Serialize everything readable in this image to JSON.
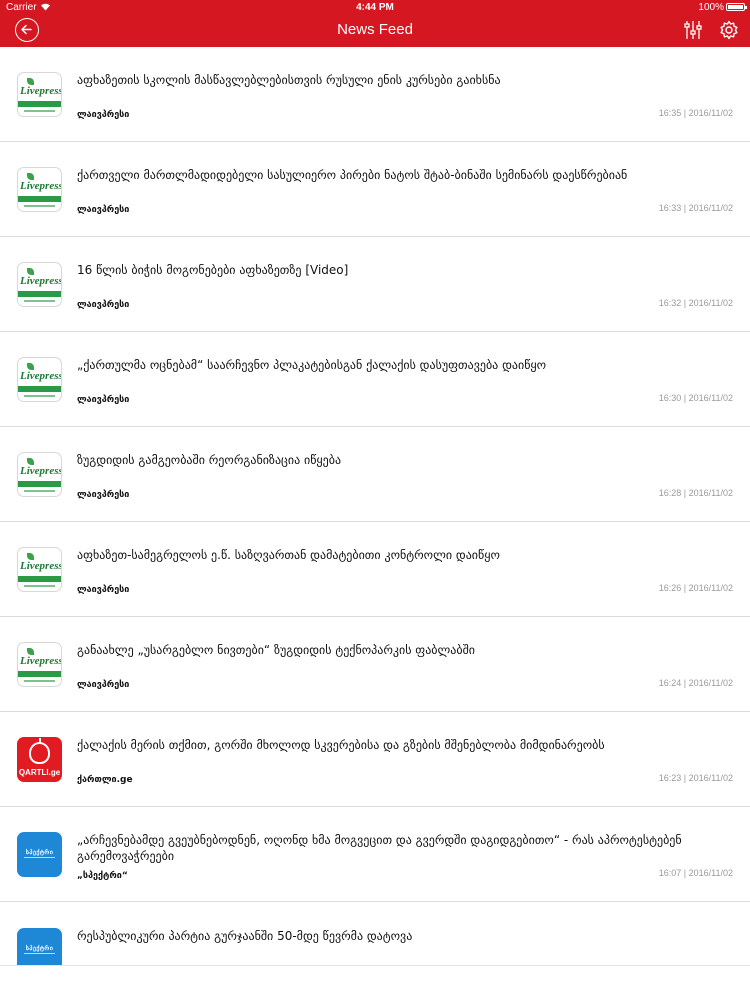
{
  "status_bar": {
    "carrier": "Carrier",
    "time": "4:44 PM",
    "battery": "100%"
  },
  "nav": {
    "title": "News Feed",
    "icons": {
      "back": "back-arrow-icon",
      "filter": "filter-sliders-icon",
      "settings": "gear-icon"
    }
  },
  "colors": {
    "brand_red": "#d51721",
    "timestamp_gray": "#9a9a9a",
    "livepress_green": "#2b9a45",
    "qartli_red": "#e11b22",
    "spectri_blue": "#1e88d6"
  },
  "feed": [
    {
      "title": "აფხაზეთის სკოლის მასწავლებლებისთვის რუსული ენის კურსები გაიხსნა",
      "source": "ლაივპრესი",
      "logo": "livepress",
      "logo_text": "Livepress",
      "time": "16:35 | 2016/11/02"
    },
    {
      "title": "ქართველი მართლმადიდებელი სასულიერო პირები ნატოს შტაბ-ბინაში სემინარს დაესწრებიან",
      "source": "ლაივპრესი",
      "logo": "livepress",
      "logo_text": "Livepress",
      "time": "16:33 | 2016/11/02"
    },
    {
      "title": "16 წლის ბიჭის მოგონებები აფხაზეთზე [Video]",
      "source": "ლაივპრესი",
      "logo": "livepress",
      "logo_text": "Livepress",
      "time": "16:32 | 2016/11/02"
    },
    {
      "title": "„ქართულმა ოცნებამ“ საარჩევნო პლაკატებისგან ქალაქის დასუფთავება დაიწყო",
      "source": "ლაივპრესი",
      "logo": "livepress",
      "logo_text": "Livepress",
      "time": "16:30 | 2016/11/02"
    },
    {
      "title": "ზუგდიდის გამგეობაში რეორგანიზაცია იწყება",
      "source": "ლაივპრესი",
      "logo": "livepress",
      "logo_text": "Livepress",
      "time": "16:28 | 2016/11/02"
    },
    {
      "title": "აფხაზეთ-სამეგრელოს ე.წ. საზღვართან დამატებითი კონტროლი დაიწყო",
      "source": "ლაივპრესი",
      "logo": "livepress",
      "logo_text": "Livepress",
      "time": "16:26 | 2016/11/02"
    },
    {
      "title": "განაახლე „უსარგებლო ნივთები“ ზუგდიდის ტექნოპარკის ფაბლაბში",
      "source": "ლაივპრესი",
      "logo": "livepress",
      "logo_text": "Livepress",
      "time": "16:24 | 2016/11/02"
    },
    {
      "title": "ქალაქის მერის თქმით, გორში მხოლოდ სკვერებისა და გზების მშენებლობა მიმდინარეობს",
      "source": "ქართლი.ge",
      "logo": "qartli",
      "logo_text": "QARTLI.ge",
      "time": "16:23 | 2016/11/02"
    },
    {
      "title": "„არჩევნებამდე გვეუბნებოდნენ, ოღონდ ხმა მოგვეცით და გვერდში დაგიდგებითო“ - რას აპროტესტებენ გარემოვაჭრეები",
      "source": "„სპექტრი“",
      "logo": "spectri",
      "logo_text": "სპექტრი",
      "time": "16:07 | 2016/11/02"
    },
    {
      "title": "რესპუბლიკური პარტია გურჯაანში 50-მდე წევრმა დატოვა",
      "source": "",
      "logo": "spectri",
      "logo_text": "სპექტრი",
      "time": ""
    }
  ]
}
